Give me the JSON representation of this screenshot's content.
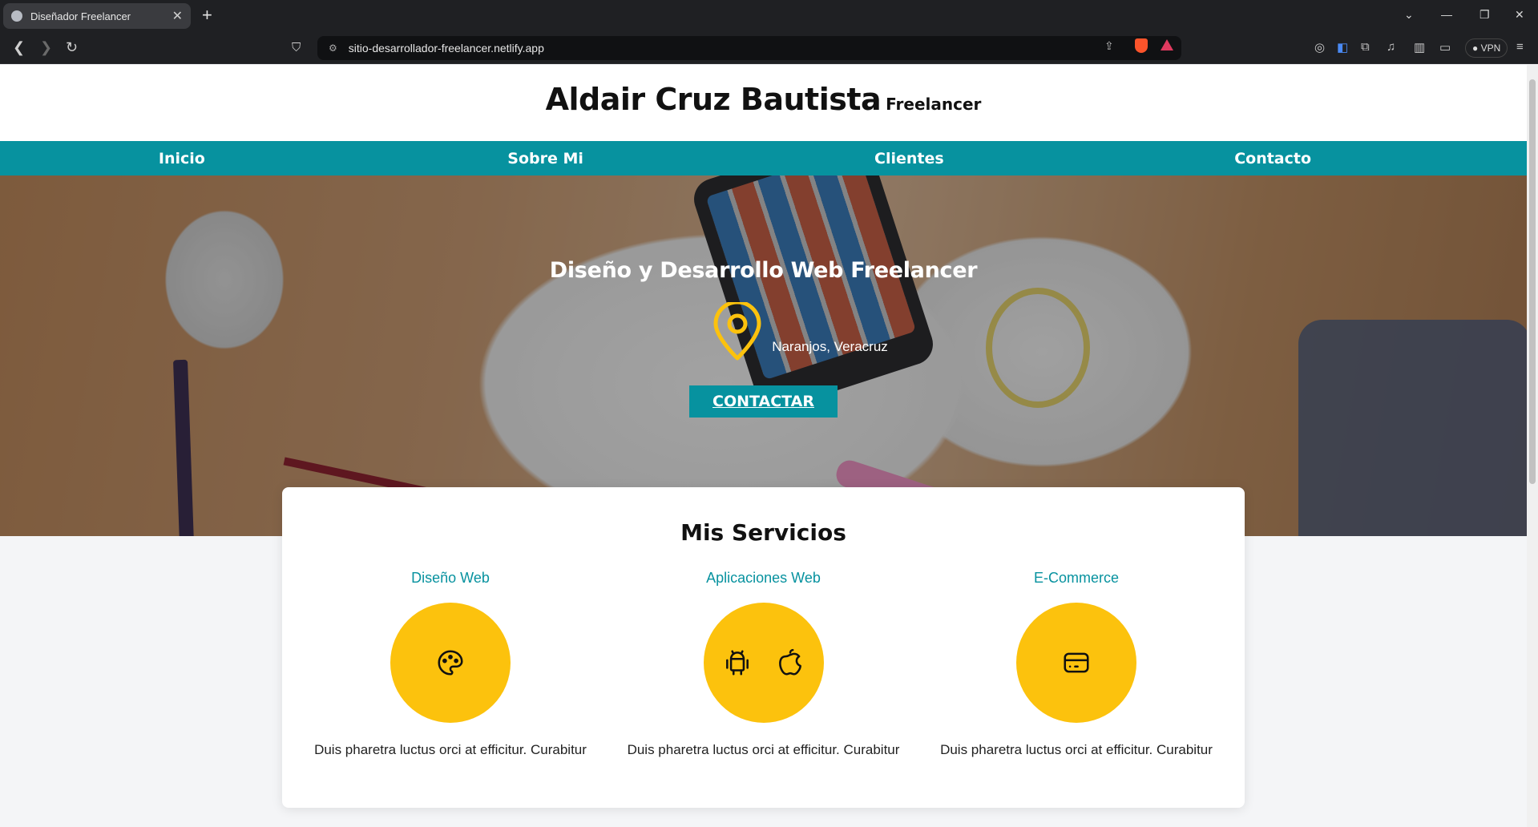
{
  "browser": {
    "tab_title": "Diseñador Freelancer",
    "url": "sitio-desarrollador-freelancer.netlify.app",
    "vpn_label": "VPN"
  },
  "header": {
    "name": "Aldair Cruz Bautista",
    "role": "Freelancer"
  },
  "nav": {
    "items": [
      "Inicio",
      "Sobre Mi",
      "Clientes",
      "Contacto"
    ]
  },
  "hero": {
    "title": "Diseño y Desarrollo Web Freelancer",
    "location": "Naranjos, Veracruz",
    "cta_label": "CONTACTAR"
  },
  "services": {
    "heading": "Mis Servicios",
    "items": [
      {
        "title": "Diseño Web",
        "icons": [
          "palette-icon"
        ],
        "text": "Duis pharetra luctus orci at efficitur. Curabitur"
      },
      {
        "title": "Aplicaciones Web",
        "icons": [
          "android-icon",
          "apple-icon"
        ],
        "text": "Duis pharetra luctus orci at efficitur. Curabitur"
      },
      {
        "title": "E-Commerce",
        "icons": [
          "credit-card-icon"
        ],
        "text": "Duis pharetra luctus orci at efficitur. Curabitur"
      }
    ]
  },
  "colors": {
    "accent": "#07929f",
    "icon_circle": "#fcc20d",
    "pin": "#fcc20d"
  }
}
